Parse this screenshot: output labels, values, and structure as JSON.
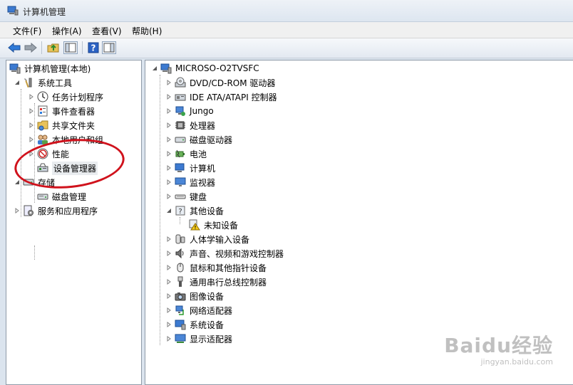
{
  "window": {
    "title": "计算机管理"
  },
  "menu": [
    {
      "label": "文件(F)"
    },
    {
      "label": "操作(A)"
    },
    {
      "label": "查看(V)"
    },
    {
      "label": "帮助(H)"
    }
  ],
  "toolbar": {
    "buttons": [
      {
        "name": "back-arrow-icon"
      },
      {
        "name": "forward-arrow-icon"
      },
      {
        "name": "up-folder-icon"
      },
      {
        "name": "show-hide-tree-icon"
      },
      {
        "name": "help-icon"
      },
      {
        "name": "action-pane-icon"
      }
    ]
  },
  "left_tree": [
    {
      "label": "计算机管理(本地)",
      "icon": "computer-management-icon",
      "expander": "none",
      "level": 0
    },
    {
      "label": "系统工具",
      "icon": "tools-icon",
      "expander": "expanded",
      "level": 1
    },
    {
      "label": "任务计划程序",
      "icon": "clock-icon",
      "expander": "collapsed",
      "level": 2
    },
    {
      "label": "事件查看器",
      "icon": "event-viewer-icon",
      "expander": "collapsed",
      "level": 2
    },
    {
      "label": "共享文件夹",
      "icon": "shared-folder-icon",
      "expander": "collapsed",
      "level": 2
    },
    {
      "label": "本地用户和组",
      "icon": "users-icon",
      "expander": "collapsed",
      "level": 2
    },
    {
      "label": "性能",
      "icon": "performance-icon",
      "expander": "collapsed",
      "level": 2
    },
    {
      "label": "设备管理器",
      "icon": "device-manager-icon",
      "expander": "none",
      "level": 2,
      "selected": true
    },
    {
      "label": "存储",
      "icon": "storage-icon",
      "expander": "expanded",
      "level": 1
    },
    {
      "label": "磁盘管理",
      "icon": "disk-management-icon",
      "expander": "none",
      "level": 2
    },
    {
      "label": "服务和应用程序",
      "icon": "services-icon",
      "expander": "collapsed",
      "level": 1
    }
  ],
  "device_tree": {
    "root": {
      "label": "MICROSO-O2TVSFC",
      "icon": "computer-icon"
    },
    "categories": [
      {
        "label": "DVD/CD-ROM 驱动器",
        "icon": "dvd-drive-icon",
        "expander": "collapsed"
      },
      {
        "label": "IDE ATA/ATAPI 控制器",
        "icon": "ide-controller-icon",
        "expander": "collapsed"
      },
      {
        "label": "Jungo",
        "icon": "jungo-device-icon",
        "expander": "collapsed"
      },
      {
        "label": "处理器",
        "icon": "processor-icon",
        "expander": "collapsed"
      },
      {
        "label": "磁盘驱动器",
        "icon": "disk-drive-icon",
        "expander": "collapsed"
      },
      {
        "label": "电池",
        "icon": "battery-icon",
        "expander": "collapsed"
      },
      {
        "label": "计算机",
        "icon": "computer-category-icon",
        "expander": "collapsed"
      },
      {
        "label": "监视器",
        "icon": "monitor-icon",
        "expander": "collapsed"
      },
      {
        "label": "键盘",
        "icon": "keyboard-icon",
        "expander": "collapsed"
      },
      {
        "label": "其他设备",
        "icon": "unknown-device-category-icon",
        "expander": "expanded"
      },
      {
        "label": "未知设备",
        "icon": "warning-device-icon",
        "expander": "none",
        "child": true
      },
      {
        "label": "人体学输入设备",
        "icon": "hid-icon",
        "expander": "collapsed"
      },
      {
        "label": "声音、视频和游戏控制器",
        "icon": "speaker-icon",
        "expander": "collapsed"
      },
      {
        "label": "鼠标和其他指针设备",
        "icon": "mouse-icon",
        "expander": "collapsed"
      },
      {
        "label": "通用串行总线控制器",
        "icon": "usb-icon",
        "expander": "collapsed"
      },
      {
        "label": "图像设备",
        "icon": "imaging-device-icon",
        "expander": "collapsed"
      },
      {
        "label": "网络适配器",
        "icon": "network-adapter-icon",
        "expander": "collapsed"
      },
      {
        "label": "系统设备",
        "icon": "system-device-icon",
        "expander": "collapsed"
      },
      {
        "label": "显示适配器",
        "icon": "display-adapter-icon",
        "expander": "collapsed"
      }
    ]
  },
  "watermark": {
    "main": "Baidu经验",
    "sub": "jingyan.baidu.com"
  },
  "colors": {
    "accent": "#1f5fbf",
    "annotation": "#d0121c",
    "selection": "#cde8ff"
  }
}
